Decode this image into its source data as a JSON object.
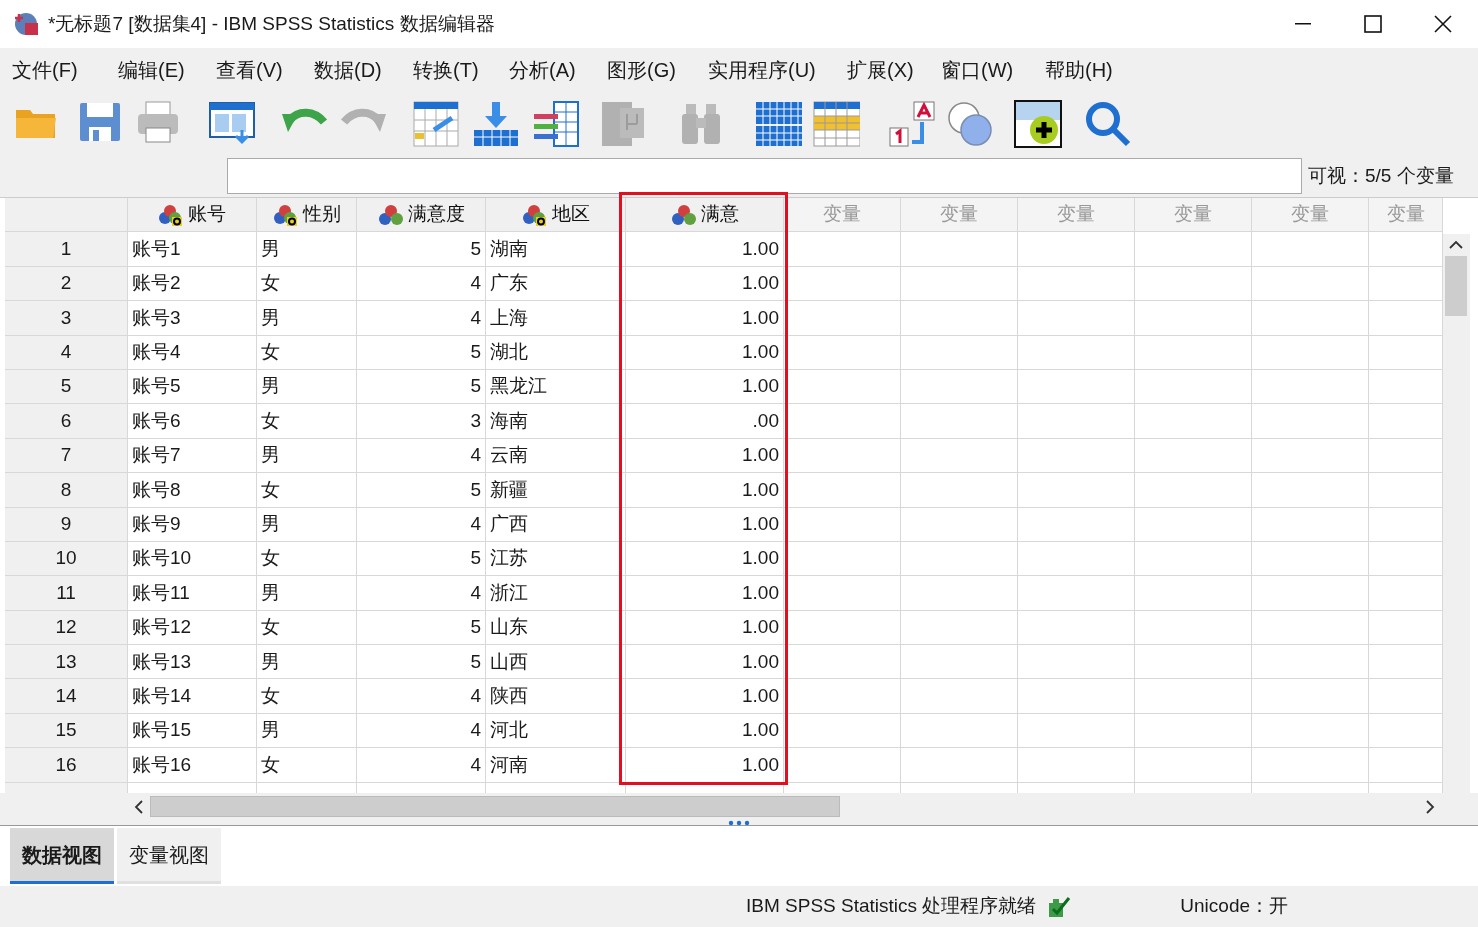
{
  "window": {
    "title": "*无标题7 [数据集4] - IBM SPSS Statistics 数据编辑器"
  },
  "menu": [
    "文件(F)",
    "编辑(E)",
    "查看(V)",
    "数据(D)",
    "转换(T)",
    "分析(A)",
    "图形(G)",
    "实用程序(U)",
    "扩展(X)",
    "窗口(W)",
    "帮助(H)"
  ],
  "toolbar": [
    {
      "kind": "open",
      "disabled": false
    },
    {
      "kind": "save",
      "disabled": false
    },
    {
      "kind": "print",
      "disabled": false
    },
    {
      "kind": "dialog",
      "disabled": false
    },
    {
      "kind": "undo",
      "disabled": false
    },
    {
      "kind": "redo",
      "disabled": true
    },
    {
      "kind": "goto",
      "disabled": false
    },
    {
      "kind": "insert",
      "disabled": false
    },
    {
      "kind": "variables",
      "disabled": false
    },
    {
      "kind": "stats",
      "disabled": true
    },
    {
      "kind": "find",
      "disabled": true
    },
    {
      "kind": "split",
      "disabled": false
    },
    {
      "kind": "select",
      "disabled": false
    },
    {
      "kind": "labels",
      "disabled": false
    },
    {
      "kind": "sets",
      "disabled": false
    },
    {
      "kind": "add",
      "disabled": false
    },
    {
      "kind": "search",
      "disabled": false
    }
  ],
  "visible_info": "可视：5/5 个变量",
  "columns": [
    {
      "name": "账号",
      "kind": "string",
      "highlighted": false
    },
    {
      "name": "性别",
      "kind": "string",
      "highlighted": false
    },
    {
      "name": "满意度",
      "kind": "ordinal",
      "highlighted": false
    },
    {
      "name": "地区",
      "kind": "string",
      "highlighted": false
    },
    {
      "name": "满意",
      "kind": "ordinal",
      "highlighted": true
    },
    {
      "name": "变量",
      "kind": "empty",
      "highlighted": false
    },
    {
      "name": "变量",
      "kind": "empty",
      "highlighted": false
    },
    {
      "name": "变量",
      "kind": "empty",
      "highlighted": false
    },
    {
      "name": "变量",
      "kind": "empty",
      "highlighted": false
    },
    {
      "name": "变量",
      "kind": "empty",
      "highlighted": false
    },
    {
      "name": "变量",
      "kind": "empty",
      "highlighted": false
    }
  ],
  "rows": [
    {
      "number": "1",
      "cells": [
        "账号1",
        "男",
        "5",
        "湖南",
        "1.00"
      ]
    },
    {
      "number": "2",
      "cells": [
        "账号2",
        "女",
        "4",
        "广东",
        "1.00"
      ]
    },
    {
      "number": "3",
      "cells": [
        "账号3",
        "男",
        "4",
        "上海",
        "1.00"
      ]
    },
    {
      "number": "4",
      "cells": [
        "账号4",
        "女",
        "5",
        "湖北",
        "1.00"
      ]
    },
    {
      "number": "5",
      "cells": [
        "账号5",
        "男",
        "5",
        "黑龙江",
        "1.00"
      ]
    },
    {
      "number": "6",
      "cells": [
        "账号6",
        "女",
        "3",
        "海南",
        ".00"
      ]
    },
    {
      "number": "7",
      "cells": [
        "账号7",
        "男",
        "4",
        "云南",
        "1.00"
      ]
    },
    {
      "number": "8",
      "cells": [
        "账号8",
        "女",
        "5",
        "新疆",
        "1.00"
      ]
    },
    {
      "number": "9",
      "cells": [
        "账号9",
        "男",
        "4",
        "广西",
        "1.00"
      ]
    },
    {
      "number": "10",
      "cells": [
        "账号10",
        "女",
        "5",
        "江苏",
        "1.00"
      ]
    },
    {
      "number": "11",
      "cells": [
        "账号11",
        "男",
        "4",
        "浙江",
        "1.00"
      ]
    },
    {
      "number": "12",
      "cells": [
        "账号12",
        "女",
        "5",
        "山东",
        "1.00"
      ]
    },
    {
      "number": "13",
      "cells": [
        "账号13",
        "男",
        "5",
        "山西",
        "1.00"
      ]
    },
    {
      "number": "14",
      "cells": [
        "账号14",
        "女",
        "4",
        "陕西",
        "1.00"
      ]
    },
    {
      "number": "15",
      "cells": [
        "账号15",
        "男",
        "4",
        "河北",
        "1.00"
      ]
    },
    {
      "number": "16",
      "cells": [
        "账号16",
        "女",
        "4",
        "河南",
        "1.00"
      ]
    }
  ],
  "tabs": [
    {
      "label": "数据视图",
      "selected": true
    },
    {
      "label": "变量视图",
      "selected": false
    }
  ],
  "status_bar": {
    "processor": "IBM SPSS Statistics 处理程序就绪",
    "unicode": "Unicode：开"
  }
}
